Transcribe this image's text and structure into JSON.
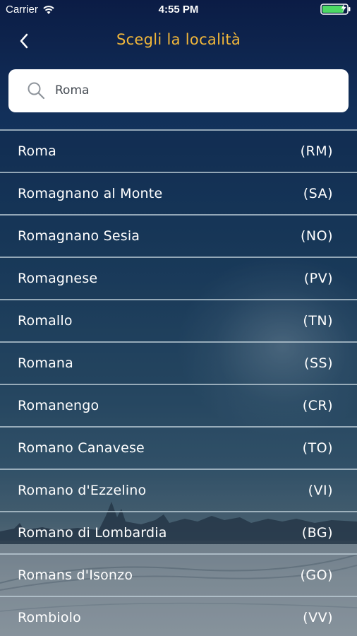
{
  "status_bar": {
    "carrier": "Carrier",
    "time": "4:55 PM",
    "wifi_icon": "wifi-icon",
    "battery_icon": "battery-charging-icon"
  },
  "nav": {
    "back_icon": "chevron-left-icon",
    "title": "Scegli la località"
  },
  "search": {
    "icon": "search-icon",
    "value": "Roma",
    "placeholder": ""
  },
  "colors": {
    "title_accent": "#f2b73a",
    "text": "#ffffff",
    "search_bg": "#ffffff"
  },
  "results": [
    {
      "name": "Roma",
      "code": "(RM)"
    },
    {
      "name": "Romagnano al Monte",
      "code": "(SA)"
    },
    {
      "name": "Romagnano Sesia",
      "code": "(NO)"
    },
    {
      "name": "Romagnese",
      "code": "(PV)"
    },
    {
      "name": "Romallo",
      "code": "(TN)"
    },
    {
      "name": "Romana",
      "code": "(SS)"
    },
    {
      "name": "Romanengo",
      "code": "(CR)"
    },
    {
      "name": "Romano Canavese",
      "code": "(TO)"
    },
    {
      "name": "Romano d'Ezzelino",
      "code": "(VI)"
    },
    {
      "name": "Romano di Lombardia",
      "code": "(BG)"
    },
    {
      "name": "Romans d'Isonzo",
      "code": "(GO)"
    },
    {
      "name": "Rombiolo",
      "code": "(VV)"
    }
  ]
}
